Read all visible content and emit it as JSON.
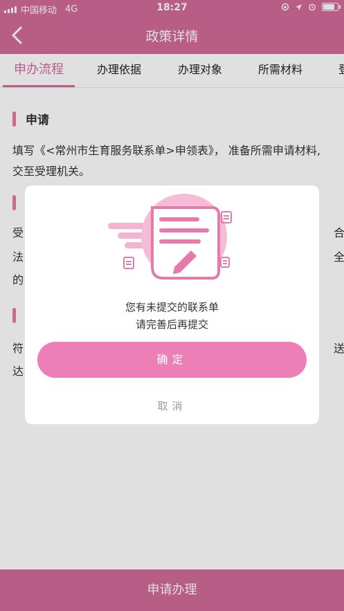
{
  "status_bar": {
    "carrier": "中国移动",
    "network": "4G",
    "time": "18:27",
    "battery_level": 0.8
  },
  "nav": {
    "title": "政策详情",
    "back_icon": "chevron-left-icon"
  },
  "tabs": [
    {
      "label": "申办流程",
      "active": true
    },
    {
      "label": "办理依据",
      "active": false
    },
    {
      "label": "办理对象",
      "active": false
    },
    {
      "label": "所需材料",
      "active": false
    },
    {
      "label": "登",
      "active": false
    }
  ],
  "sections": [
    {
      "title": "申请",
      "text": "填写《<常州市生育服务联系单>申领表》， 准备所需申请材料,交至受理机关。"
    },
    {
      "title": "",
      "text_left": "受",
      "text_right": "合",
      "text_left2": "法",
      "text_right2": "全",
      "text_left3": "的"
    },
    {
      "title": "",
      "text_left": "符",
      "text_right": "送",
      "text_left2": "达"
    }
  ],
  "dialog": {
    "illustration": "form-edit-icon",
    "message_line1": "您有未提交的联系单",
    "message_line2": "请完善后再提交",
    "confirm_label": "确定",
    "cancel_label": "取消"
  },
  "bottom_button": {
    "label": "申请办理"
  },
  "colors": {
    "primary": "#d26a99",
    "button_pink": "#ec7fb5",
    "accent_bar": "#e57ba9"
  }
}
